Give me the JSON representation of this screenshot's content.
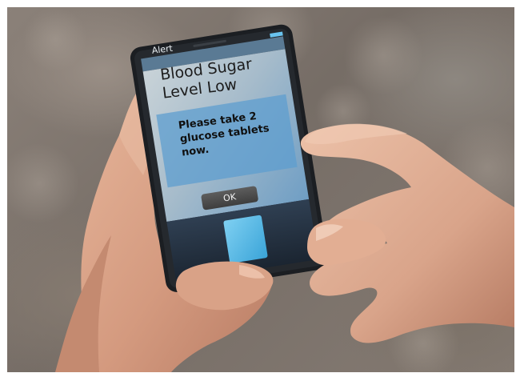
{
  "alert": {
    "header": "Alert",
    "title": "Blood Sugar\nLevel Low",
    "message": "Please take 2\nglucose tablets\nnow.",
    "ok_label": "OK"
  },
  "colors": {
    "screen_blue": "#4d8fc4",
    "sensor_pad": "#59b6e6",
    "phone_body": "#1f2226",
    "skin": "#d9a58b"
  },
  "icons": {
    "sensor": "fingerprint-sensor-pad"
  }
}
